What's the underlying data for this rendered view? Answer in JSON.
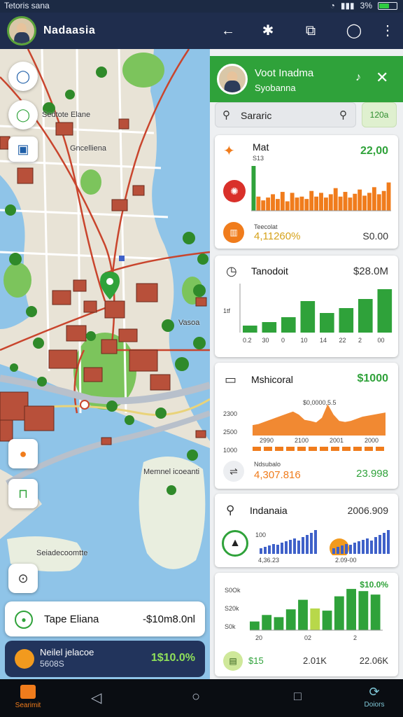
{
  "status": {
    "left": "Tetoris sana",
    "battery": "3%"
  },
  "topbar": {
    "title": "Nadaasia"
  },
  "map": {
    "labels": [
      "Sedtote Elane",
      "Gncelliena",
      "Vasoa",
      "Memnel icoeanti",
      "Seiadecoomtte"
    ]
  },
  "map_card_1": {
    "label": "Tape Eliana",
    "value": "-$10m8.0nl"
  },
  "map_card_2": {
    "title": "Neilel jelacoe",
    "subtitle": "5608S",
    "value": "1$10.0%"
  },
  "panel": {
    "header": {
      "title": "Voot Inadma",
      "subtitle": "Syobanna"
    },
    "search_placeholder": "Sararic",
    "search_button": "120a",
    "cards": [
      {
        "title": "Mat",
        "sub": "S13",
        "value": "22,00",
        "foot_label": "Teecolat",
        "foot_value": "4,11260%",
        "foot_right": "S0.00"
      },
      {
        "title": "Tanodoit",
        "value": "$28.0M",
        "y_tick": "1tf",
        "x_ticks": [
          "0.2",
          "30",
          "0",
          "10",
          "14",
          "22",
          "2",
          "00"
        ]
      },
      {
        "title": "Mshicoral",
        "value": "$1000",
        "y_ticks": [
          "2300",
          "2500",
          "1000"
        ],
        "x_ticks": [
          "2990",
          "2100",
          "2001",
          "2000"
        ],
        "peak_label": "$0,0000,5.5",
        "foot_label": "Ndsubalo",
        "foot_value": "4,307.816",
        "foot_right": "23.998"
      },
      {
        "title": "Indanaia",
        "value": "2006.909",
        "y_tick": "100",
        "x_ticks": [
          "4,36.23",
          "2.09-00"
        ]
      },
      {
        "value": "$10.0%",
        "y_ticks": [
          "S0Ok",
          "S20k",
          "S0k"
        ],
        "x_ticks": [
          "20",
          "02",
          "2"
        ],
        "foot_left": "$15",
        "foot_mid": "2.01K",
        "foot_right": "22.06K"
      }
    ]
  },
  "nav": {
    "left": "Searimit",
    "right": "Doiors"
  },
  "colors": {
    "green": "#2fa23a",
    "orange": "#f07c1c",
    "navy": "#1f2d4d",
    "blue": "#3f61c9"
  },
  "chart_data": [
    {
      "type": "bar",
      "title": "Mat",
      "values": [
        95,
        30,
        22,
        28,
        35,
        25,
        40,
        20,
        38,
        28,
        30,
        25,
        42,
        30,
        38,
        28,
        35,
        48,
        30,
        40,
        28,
        36,
        45,
        32,
        38,
        50,
        35,
        42,
        60
      ]
    },
    {
      "type": "bar",
      "title": "Tanodoit",
      "categories": [
        "0.2",
        "30",
        "0",
        "10",
        "14",
        "22",
        "2",
        "00"
      ],
      "values": [
        10,
        15,
        22,
        45,
        28,
        35,
        48,
        62
      ]
    },
    {
      "type": "area",
      "title": "Mshicoral",
      "values": [
        20,
        22,
        26,
        30,
        34,
        38,
        42,
        46,
        40,
        30,
        28,
        25,
        34,
        60,
        40,
        28,
        26,
        28,
        32,
        36,
        38,
        40,
        42,
        44
      ]
    },
    {
      "type": "bar",
      "title": "Indanaia",
      "values": [
        8,
        10,
        12,
        14,
        13,
        16,
        18,
        20,
        22,
        19,
        24,
        27,
        30,
        34
      ]
    },
    {
      "type": "bar",
      "categories": [
        "20",
        "02",
        "2"
      ],
      "values": [
        20,
        35,
        30,
        48,
        70,
        50,
        45,
        78,
        95,
        90,
        82
      ]
    }
  ]
}
